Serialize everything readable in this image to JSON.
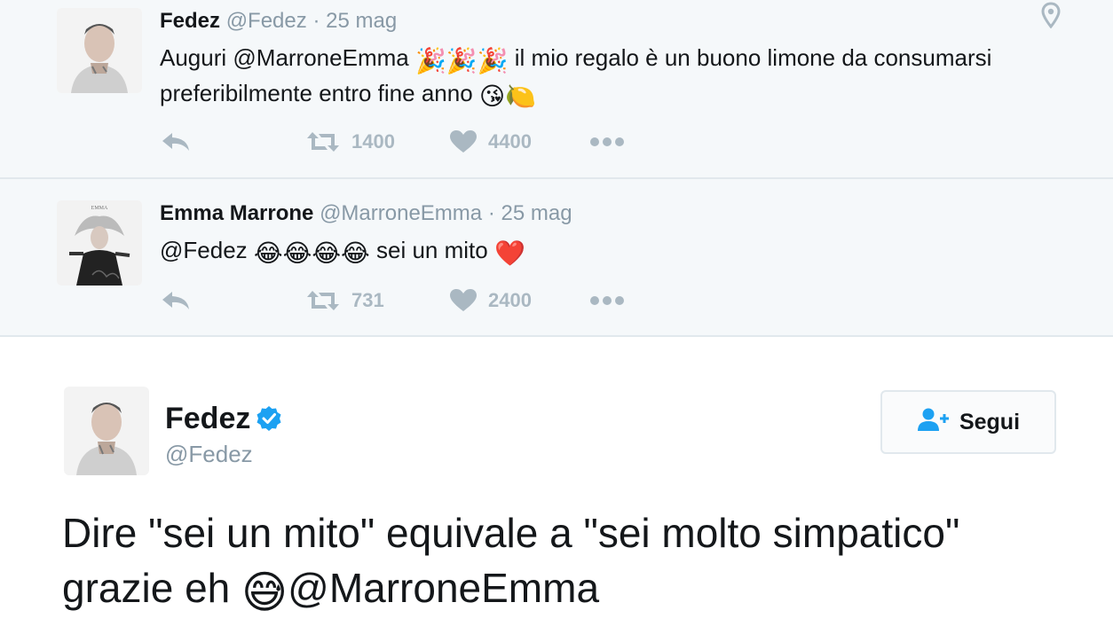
{
  "tweets": [
    {
      "name": "Fedez",
      "handle": "@Fedez",
      "sep": "·",
      "date": "25 mag",
      "text_before": "Auguri ",
      "mention": "@MarroneEmma",
      "emojis_1": "🎉🎉🎉",
      "text_after": " il mio regalo è un buono limone da consumarsi preferibilmente entro fine anno ",
      "emojis_2": "😘🍋",
      "retweets": "1400",
      "likes": "4400"
    },
    {
      "name": "Emma Marrone",
      "handle": "@MarroneEmma",
      "sep": "·",
      "date": "25 mag",
      "mention": "@Fedez",
      "emojis_1": "😂😂😂😂",
      "text_after": " sei un mito ",
      "emojis_2": "❤️",
      "avatar_caption": "EMMA",
      "retweets": "731",
      "likes": "2400"
    }
  ],
  "main_tweet": {
    "name": "Fedez",
    "handle": "@Fedez",
    "follow_label": "Segui",
    "text_line": "Dire \"sei un mito\" equivale a \"sei molto simpatico\" grazie eh ",
    "emoji": "😅",
    "mention": "@MarroneEmma"
  },
  "colors": {
    "accent": "#1da1f2",
    "muted": "#8899a6",
    "icon": "#aab8c2",
    "reply_bg": "#f5f8fa"
  }
}
